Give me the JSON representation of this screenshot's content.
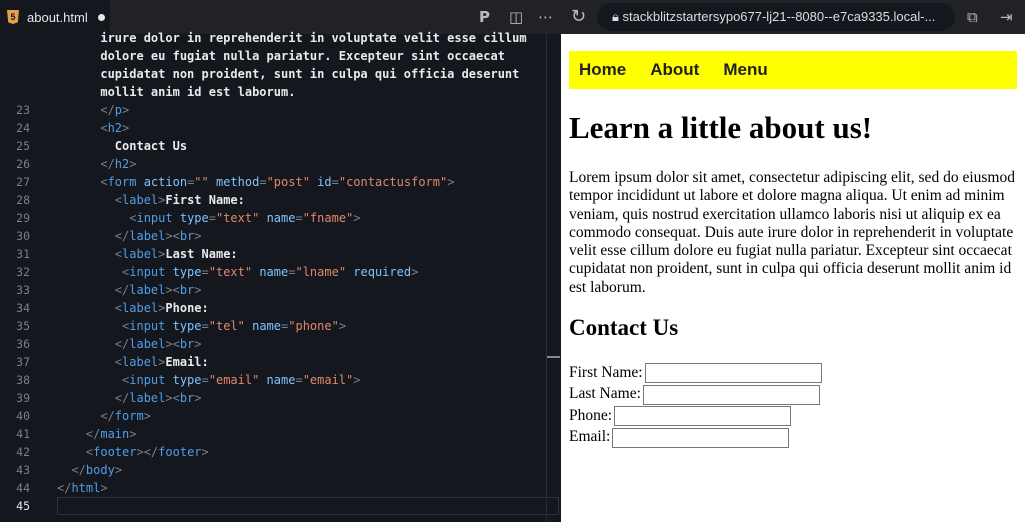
{
  "tab": {
    "filename": "about.html"
  },
  "browser": {
    "url": "stackblitzstartersypo677-lj21--8080--e7ca9335.local-..."
  },
  "code_lines": [
    {
      "num": "",
      "tokens": [
        [
          "t-txt",
          "      irure dolor in reprehenderit in voluptate velit esse cillum"
        ]
      ]
    },
    {
      "num": "",
      "tokens": [
        [
          "t-txt",
          "      dolore eu fugiat nulla pariatur. Excepteur sint occaecat"
        ]
      ]
    },
    {
      "num": "",
      "tokens": [
        [
          "t-txt",
          "      cupidatat non proident, sunt in culpa qui officia deserunt"
        ]
      ]
    },
    {
      "num": "",
      "tokens": [
        [
          "t-txt",
          "      mollit anim id est laborum."
        ]
      ]
    },
    {
      "num": "23",
      "tokens": [
        [
          "t-p",
          "      </"
        ],
        [
          "t-tag",
          "p"
        ],
        [
          "t-p",
          ">"
        ]
      ]
    },
    {
      "num": "24",
      "tokens": [
        [
          "t-p",
          "      <"
        ],
        [
          "t-tag",
          "h2"
        ],
        [
          "t-p",
          ">"
        ]
      ]
    },
    {
      "num": "25",
      "tokens": [
        [
          "t-txt",
          "        Contact Us"
        ]
      ]
    },
    {
      "num": "26",
      "tokens": [
        [
          "t-p",
          "      </"
        ],
        [
          "t-tag",
          "h2"
        ],
        [
          "t-p",
          ">"
        ]
      ]
    },
    {
      "num": "27",
      "tokens": [
        [
          "t-p",
          "      <"
        ],
        [
          "t-tag",
          "form "
        ],
        [
          "t-attr",
          "action"
        ],
        [
          "t-p",
          "="
        ],
        [
          "t-str",
          "\"\" "
        ],
        [
          "t-attr",
          "method"
        ],
        [
          "t-p",
          "="
        ],
        [
          "t-str",
          "\"post\" "
        ],
        [
          "t-attr",
          "id"
        ],
        [
          "t-p",
          "="
        ],
        [
          "t-str",
          "\"contactusform\""
        ],
        [
          "t-p",
          ">"
        ]
      ]
    },
    {
      "num": "28",
      "tokens": [
        [
          "t-p",
          "        <"
        ],
        [
          "t-tag",
          "label"
        ],
        [
          "t-p",
          ">"
        ],
        [
          "t-txt",
          "First Name:"
        ]
      ]
    },
    {
      "num": "29",
      "tokens": [
        [
          "t-p",
          "          <"
        ],
        [
          "t-tag",
          "input "
        ],
        [
          "t-attr",
          "type"
        ],
        [
          "t-p",
          "="
        ],
        [
          "t-str",
          "\"text\" "
        ],
        [
          "t-attr",
          "name"
        ],
        [
          "t-p",
          "="
        ],
        [
          "t-str",
          "\"fname\""
        ],
        [
          "t-p",
          ">"
        ]
      ]
    },
    {
      "num": "30",
      "tokens": [
        [
          "t-p",
          "        </"
        ],
        [
          "t-tag",
          "label"
        ],
        [
          "t-p",
          "><"
        ],
        [
          "t-tag",
          "br"
        ],
        [
          "t-p",
          ">"
        ]
      ]
    },
    {
      "num": "31",
      "tokens": [
        [
          "t-p",
          "        <"
        ],
        [
          "t-tag",
          "label"
        ],
        [
          "t-p",
          ">"
        ],
        [
          "t-txt",
          "Last Name:"
        ]
      ]
    },
    {
      "num": "32",
      "tokens": [
        [
          "t-p",
          "         <"
        ],
        [
          "t-tag",
          "input "
        ],
        [
          "t-attr",
          "type"
        ],
        [
          "t-p",
          "="
        ],
        [
          "t-str",
          "\"text\" "
        ],
        [
          "t-attr",
          "name"
        ],
        [
          "t-p",
          "="
        ],
        [
          "t-str",
          "\"lname\" "
        ],
        [
          "t-attr",
          "required"
        ],
        [
          "t-p",
          ">"
        ]
      ]
    },
    {
      "num": "33",
      "tokens": [
        [
          "t-p",
          "        </"
        ],
        [
          "t-tag",
          "label"
        ],
        [
          "t-p",
          "><"
        ],
        [
          "t-tag",
          "br"
        ],
        [
          "t-p",
          ">"
        ]
      ]
    },
    {
      "num": "34",
      "tokens": [
        [
          "t-p",
          "        <"
        ],
        [
          "t-tag",
          "label"
        ],
        [
          "t-p",
          ">"
        ],
        [
          "t-txt",
          "Phone:"
        ]
      ]
    },
    {
      "num": "35",
      "tokens": [
        [
          "t-p",
          "         <"
        ],
        [
          "t-tag",
          "input "
        ],
        [
          "t-attr",
          "type"
        ],
        [
          "t-p",
          "="
        ],
        [
          "t-str",
          "\"tel\" "
        ],
        [
          "t-attr",
          "name"
        ],
        [
          "t-p",
          "="
        ],
        [
          "t-str",
          "\"phone\""
        ],
        [
          "t-p",
          ">"
        ]
      ]
    },
    {
      "num": "36",
      "tokens": [
        [
          "t-p",
          "        </"
        ],
        [
          "t-tag",
          "label"
        ],
        [
          "t-p",
          "><"
        ],
        [
          "t-tag",
          "br"
        ],
        [
          "t-p",
          ">"
        ]
      ]
    },
    {
      "num": "37",
      "tokens": [
        [
          "t-p",
          "        <"
        ],
        [
          "t-tag",
          "label"
        ],
        [
          "t-p",
          ">"
        ],
        [
          "t-txt",
          "Email:"
        ]
      ]
    },
    {
      "num": "38",
      "tokens": [
        [
          "t-p",
          "         <"
        ],
        [
          "t-tag",
          "input "
        ],
        [
          "t-attr",
          "type"
        ],
        [
          "t-p",
          "="
        ],
        [
          "t-str",
          "\"email\" "
        ],
        [
          "t-attr",
          "name"
        ],
        [
          "t-p",
          "="
        ],
        [
          "t-str",
          "\"email\""
        ],
        [
          "t-p",
          ">"
        ]
      ]
    },
    {
      "num": "39",
      "tokens": [
        [
          "t-p",
          "        </"
        ],
        [
          "t-tag",
          "label"
        ],
        [
          "t-p",
          "><"
        ],
        [
          "t-tag",
          "br"
        ],
        [
          "t-p",
          ">"
        ]
      ]
    },
    {
      "num": "40",
      "tokens": [
        [
          "t-p",
          "      </"
        ],
        [
          "t-tag",
          "form"
        ],
        [
          "t-p",
          ">"
        ]
      ]
    },
    {
      "num": "41",
      "tokens": [
        [
          "t-p",
          "    </"
        ],
        [
          "t-tag",
          "main"
        ],
        [
          "t-p",
          ">"
        ]
      ]
    },
    {
      "num": "42",
      "tokens": [
        [
          "t-p",
          "    <"
        ],
        [
          "t-tag",
          "footer"
        ],
        [
          "t-p",
          "></"
        ],
        [
          "t-tag",
          "footer"
        ],
        [
          "t-p",
          ">"
        ]
      ]
    },
    {
      "num": "43",
      "tokens": [
        [
          "t-p",
          "  </"
        ],
        [
          "t-tag",
          "body"
        ],
        [
          "t-p",
          ">"
        ]
      ]
    },
    {
      "num": "44",
      "tokens": [
        [
          "t-p",
          "</"
        ],
        [
          "t-tag",
          "html"
        ],
        [
          "t-p",
          ">"
        ]
      ]
    },
    {
      "num": "45",
      "tokens": []
    }
  ],
  "page": {
    "nav": [
      "Home",
      "About",
      "Menu"
    ],
    "title": "Learn a little about us!",
    "paragraph": "Lorem ipsum dolor sit amet, consectetur adipiscing elit, sed do eiusmod tempor incididunt ut labore et dolore magna aliqua. Ut enim ad minim veniam, quis nostrud exercitation ullamco laboris nisi ut aliquip ex ea commodo consequat. Duis aute irure dolor in reprehenderit in voluptate velit esse cillum dolore eu fugiat nulla pariatur. Excepteur sint occaecat cupidatat non proident, sunt in culpa qui officia deserunt mollit anim id est laborum.",
    "contact_heading": "Contact Us",
    "form": {
      "first_name": "First Name:",
      "last_name": "Last Name:",
      "phone": "Phone:",
      "email": "Email:"
    }
  },
  "colors": {
    "nav_bg": "#ffff00",
    "editor_bg": "#15171e"
  }
}
